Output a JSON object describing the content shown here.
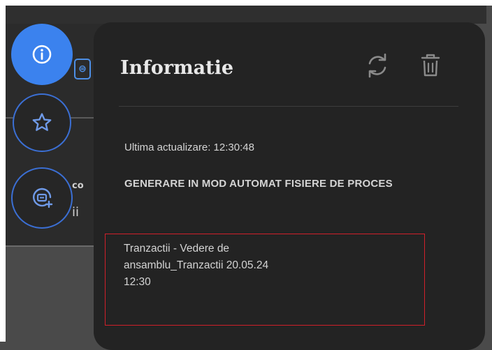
{
  "background": {
    "partial_label_1": "co",
    "partial_label_2": "ii"
  },
  "panel": {
    "title": "Informatie",
    "last_update": "Ultima actualizare: 12:30:48",
    "section_title": "GENERARE IN MOD AUTOMAT FISIERE DE PROCES",
    "entry": {
      "line1": "Tranzactii - Vedere de",
      "line2": "ansamblu_Tranzactii 20.05.24",
      "line3": "12:30"
    }
  },
  "colors": {
    "accent": "#3b82ee",
    "panel_bg": "#232323",
    "highlight_border": "#d0202a"
  }
}
